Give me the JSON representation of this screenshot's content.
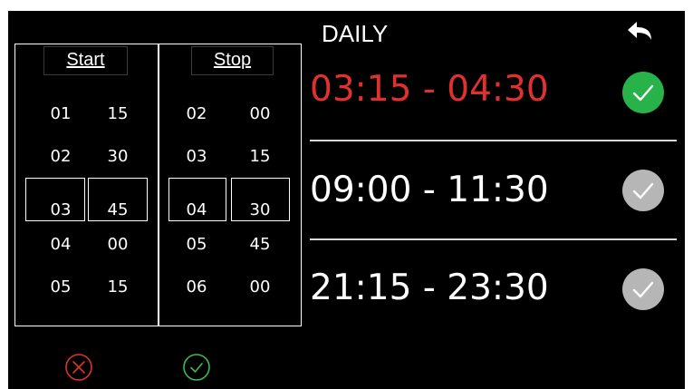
{
  "header": {
    "title": "DAILY",
    "back_icon": "back-arrow-icon"
  },
  "start": {
    "label": "Start",
    "hours": [
      "01",
      "02",
      "03",
      "04",
      "05"
    ],
    "minutes": [
      "15",
      "30",
      "45",
      "00",
      "15"
    ],
    "selected_hour": "03",
    "selected_minute": "45"
  },
  "stop": {
    "label": "Stop",
    "hours": [
      "02",
      "03",
      "04",
      "05",
      "06"
    ],
    "minutes": [
      "00",
      "15",
      "30",
      "45",
      "00"
    ],
    "selected_hour": "04",
    "selected_minute": "30"
  },
  "schedules": [
    {
      "range": "03:15 - 04:30",
      "enabled": true
    },
    {
      "range": "09:00 - 11:30",
      "enabled": false
    },
    {
      "range": "21:15 - 23:30",
      "enabled": false
    }
  ],
  "actions": {
    "cancel_icon": "cancel-x-icon",
    "confirm_icon": "confirm-check-icon"
  },
  "colors": {
    "active": "#e0312f",
    "enabled_check": "#27b34a",
    "disabled_check": "#b6b6b6",
    "cancel": "#e0312f",
    "confirm": "#3dbb4f"
  }
}
